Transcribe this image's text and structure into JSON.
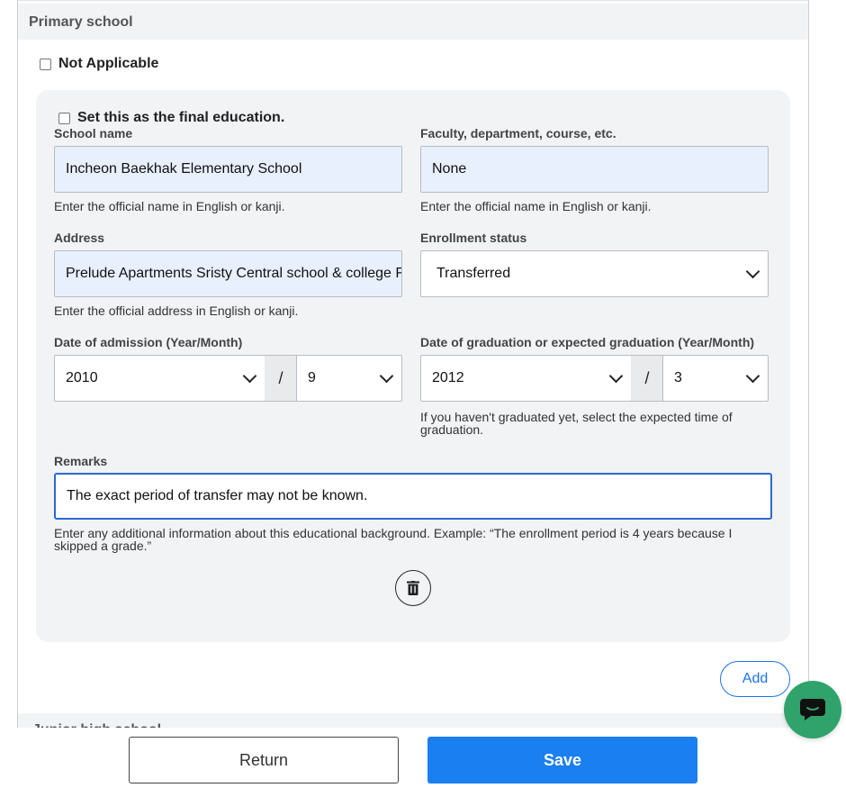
{
  "section": {
    "title": "Primary school",
    "next_title": "Junior high school"
  },
  "not_applicable": {
    "label": "Not Applicable",
    "checked": false
  },
  "entry": {
    "final_education": {
      "label": "Set this as the final education.",
      "checked": false
    },
    "school_name": {
      "label": "School name",
      "value": "Incheon Baekhak Elementary School",
      "help": "Enter the official name in English or kanji."
    },
    "faculty": {
      "label": "Faculty, department, course, etc.",
      "value": "None",
      "help": "Enter the official name in English or kanji."
    },
    "address": {
      "label": "Address",
      "value": "Prelude Apartments Sristy Central school & college F",
      "help": "Enter the official address in English or kanji."
    },
    "enrollment_status": {
      "label": "Enrollment status",
      "value": "Transferred"
    },
    "admission": {
      "label": "Date of admission (Year/Month)",
      "year": "2010",
      "separator": "/",
      "month": "9"
    },
    "graduation": {
      "label": "Date of graduation or expected graduation (Year/Month)",
      "year": "2012",
      "separator": "/",
      "month": "3",
      "help": "If you haven't graduated yet, select the expected time of graduation."
    },
    "remarks": {
      "label": "Remarks",
      "value": "The exact period of transfer may not be known.",
      "help": "Enter any additional information about this educational background. Example: “The enrollment period is 4 years because I skipped a grade.”"
    },
    "delete_icon": "trash-icon"
  },
  "add_button": "Add",
  "footer": {
    "return_label": "Return",
    "save_label": "Save"
  },
  "chat_icon": "chat-bubble-icon",
  "colors": {
    "primary": "#1a7ff0",
    "autofill_bg": "#e8f0fe",
    "card_bg": "#f2f3f5",
    "chat": "#2fa36b"
  }
}
